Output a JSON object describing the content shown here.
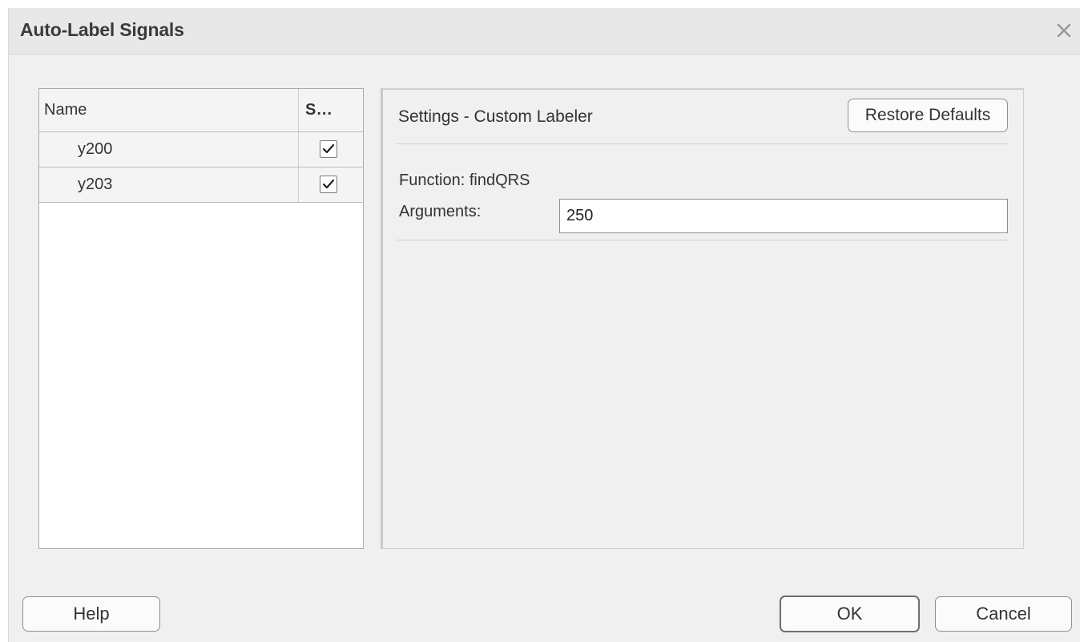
{
  "dialog": {
    "title": "Auto-Label Signals"
  },
  "table": {
    "columns": [
      "Name",
      "S..."
    ],
    "rows": [
      {
        "name": "y200",
        "selected": true
      },
      {
        "name": "y203",
        "selected": true
      }
    ]
  },
  "settings": {
    "title": "Settings - Custom Labeler",
    "restore_label": "Restore Defaults",
    "function_text": "Function: findQRS",
    "arguments_label": "Arguments:",
    "arguments_value": "250"
  },
  "buttons": {
    "help": "Help",
    "ok": "OK",
    "cancel": "Cancel"
  },
  "icons": {
    "close": "close-icon",
    "check": "checkmark-icon"
  }
}
